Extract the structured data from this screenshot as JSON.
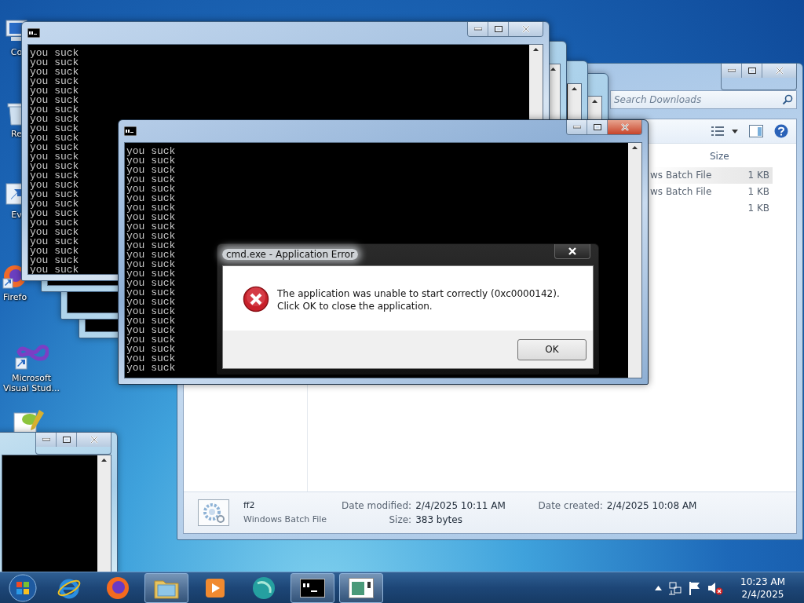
{
  "desktop_icons": [
    {
      "kind": "computer",
      "label": "Co"
    },
    {
      "kind": "bin",
      "label": "Re"
    },
    {
      "kind": "shortcut",
      "label": "Ev"
    },
    {
      "kind": "firefox",
      "label": "Firefo"
    },
    {
      "kind": "vs",
      "label": "Microsoft Visual Stud..."
    },
    {
      "kind": "notepad"
    }
  ],
  "console_windows": [
    {
      "active": false,
      "lines": [
        "you suck",
        "you suck",
        "you suck",
        "you suck",
        "you suck",
        "you suck",
        "you suck",
        "you suck",
        "you suck",
        "you suck",
        "you suck",
        "you suck",
        "you suck",
        "you suck",
        "you suck",
        "you suck",
        "you suck",
        "you suck",
        "you suck",
        "you suck",
        "you suck",
        "you suck",
        "you suck",
        "you suck"
      ]
    },
    {
      "active": true,
      "lines": [
        "you suck",
        "you suck",
        "you suck",
        "you suck",
        "you suck",
        "you suck",
        "you suck",
        "you suck",
        "you suck",
        "you suck",
        "you suck",
        "you suck",
        "you suck",
        "you suck",
        "you suck",
        "you suck",
        "you suck",
        "you suck",
        "you suck",
        "you suck",
        "you suck",
        "you suck",
        "you suck",
        "you suck"
      ]
    }
  ],
  "explorer": {
    "search": {
      "placeholder": "Search Downloads"
    },
    "columns": [
      "Size"
    ],
    "rows": [
      {
        "type": "ws Batch File",
        "size": "1 KB",
        "selected": true
      },
      {
        "type": "ws Batch File",
        "size": "1 KB",
        "selected": false
      },
      {
        "size": "1 KB",
        "selected": false
      }
    ],
    "details": {
      "name": "ff2",
      "type": "Windows Batch File",
      "fields": [
        {
          "label": "Date modified:",
          "value": "2/4/2025 10:11 AM"
        },
        {
          "label": "Size:",
          "value": "383 bytes"
        },
        {
          "label": "Date created:",
          "value": "2/4/2025 10:08 AM"
        }
      ]
    }
  },
  "dialog": {
    "title": "cmd.exe - Application Error",
    "message": "The application was unable to start correctly (0xc0000142). Click OK to close the application.",
    "button": "OK"
  },
  "taskbar": {
    "items": [
      {
        "kind": "ie",
        "active": false
      },
      {
        "kind": "firefox",
        "active": false
      },
      {
        "kind": "folder",
        "active": true
      },
      {
        "kind": "media",
        "active": false
      },
      {
        "kind": "globe",
        "active": false
      },
      {
        "kind": "console",
        "active": true
      },
      {
        "kind": "window",
        "active": true
      }
    ],
    "clock": {
      "time": "10:23 AM",
      "date": "2/4/2025"
    }
  }
}
